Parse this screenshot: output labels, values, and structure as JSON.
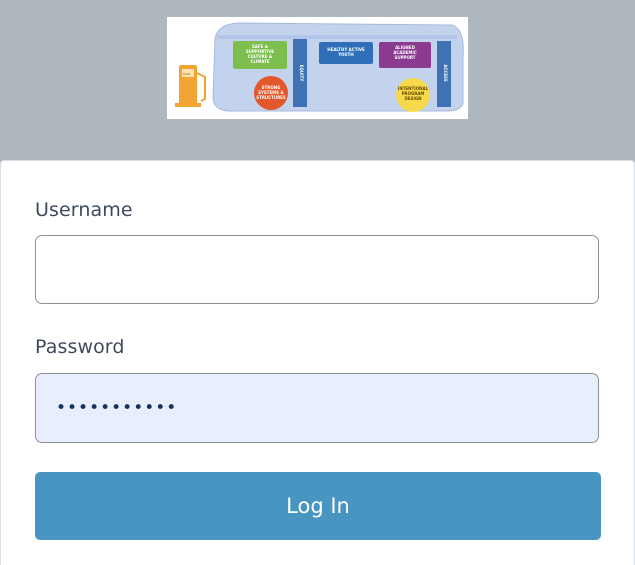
{
  "logo": {
    "icon": "bus-framework-logo",
    "blocks": {
      "safe_supportive": [
        "SAFE &",
        "SUPPORTIVE",
        "CULTURE &",
        "CLIMATE"
      ],
      "healthy_active": [
        "HEALTHY ACTIVE",
        "YOUTH"
      ],
      "aligned_academic": [
        "ALIGNED",
        "ACADEMIC",
        "SUPPORT"
      ],
      "strong_systems": [
        "STRONG",
        "SYSTEMS &",
        "STRUCTURES"
      ],
      "intentional_program": [
        "INTENTIONAL",
        "PROGRAM",
        "DESIGN"
      ],
      "equity": "EQUITY",
      "access": "ACCESS",
      "gas": "GAS"
    }
  },
  "form": {
    "username_label": "Username",
    "username_value": "",
    "password_label": "Password",
    "password_value": "aaaaaaaaaaa",
    "login_label": "Log In"
  },
  "colors": {
    "background": "#b0b8bf",
    "button": "#4795c0",
    "password_fill": "#e8eefc"
  }
}
